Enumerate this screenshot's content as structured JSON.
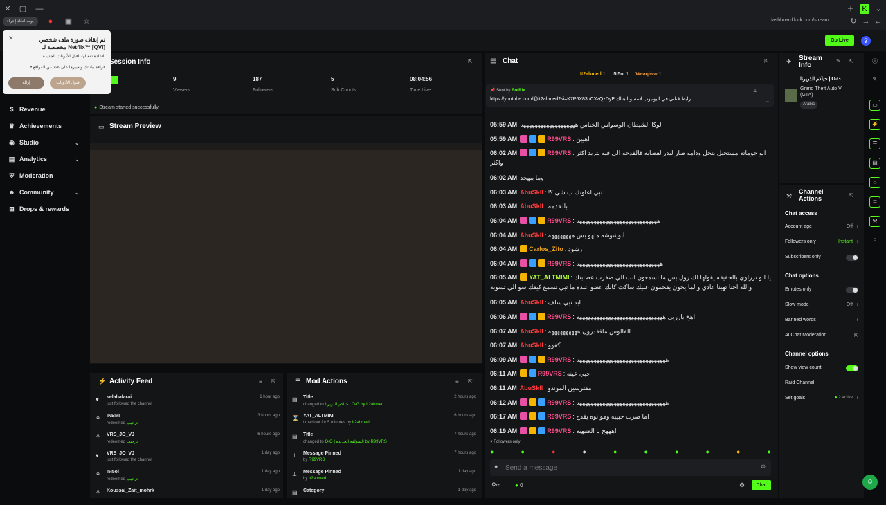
{
  "browser": {
    "url": "dashboard.kick.com/stream",
    "tab_chip": "يوب اتخاذ إجراء"
  },
  "toast": {
    "title": "تم إيقاف صورة ملف شخصي مخصصة لـ Netflix™ [QVI]",
    "line1": "لإعادة تفعيلها، اقبل الأذونات الجديدة.",
    "line2": "• قراءة بياناتك وتغييرها على عدد من المواقع",
    "accept": "قبول الأذونات",
    "remove": "إزالة"
  },
  "header": {
    "go_live": "Go Live",
    "help": "?"
  },
  "sidebar": {
    "items": [
      {
        "label": "Revenue",
        "icon": "dollar-icon"
      },
      {
        "label": "Achievements",
        "icon": "trophy-icon"
      },
      {
        "label": "Studio",
        "icon": "studio-icon"
      },
      {
        "label": "Analytics",
        "icon": "chart-icon"
      },
      {
        "label": "Moderation",
        "icon": "shield-icon"
      },
      {
        "label": "Community",
        "icon": "users-icon"
      },
      {
        "label": "Drops & rewards",
        "icon": "gift-icon"
      }
    ]
  },
  "session": {
    "title": "Session Info",
    "stats": [
      {
        "value": "9",
        "label": "Viewers"
      },
      {
        "value": "187",
        "label": "Followers"
      },
      {
        "value": "5",
        "label": "Sub Counts"
      },
      {
        "value": "08:04:56",
        "label": "Time Live"
      }
    ],
    "status": "Stream started successfully."
  },
  "preview": {
    "title": "Stream Preview"
  },
  "activity": {
    "title": "Activity Feed",
    "items": [
      {
        "name": "selahalarai",
        "sub": "just followed the channel",
        "extra": "",
        "time": "1 hour ago"
      },
      {
        "name": "INBMI",
        "sub": "redeemed",
        "extra": "ترحيب",
        "time": "3 hours ago"
      },
      {
        "name": "VRS_JO_VJ",
        "sub": "redeemed",
        "extra": "ترحيب",
        "time": "6 hours ago"
      },
      {
        "name": "VRS_JO_VJ",
        "sub": "just followed the channel",
        "extra": "",
        "time": "1 day ago"
      },
      {
        "name": "I5I5ol",
        "sub": "redeemed",
        "extra": "ترحيب",
        "time": "1 day ago"
      },
      {
        "name": "Koussai_Zait_mohrk",
        "sub": "",
        "extra": "",
        "time": "1 day ago"
      }
    ]
  },
  "mod": {
    "title": "Mod Actions",
    "items": [
      {
        "name": "Title",
        "sub": "changed to",
        "extra": "حياكم الذريرنا | O-G by It2ahmed",
        "time": "2 hours ago"
      },
      {
        "name": "YAT_ALTMIMI",
        "sub": "timed out for 5 minutes by",
        "extra": "It2ahmed",
        "time": "6 hours ago"
      },
      {
        "name": "Title",
        "sub": "changed to",
        "extra": "O-G | السولفة الجديدة by R99VRS",
        "time": "7 hours ago"
      },
      {
        "name": "Message Pinned",
        "sub": "by",
        "extra": "R99VRS",
        "time": "7 hours ago"
      },
      {
        "name": "Message Pinned",
        "sub": "by",
        "extra": "It2ahmed",
        "time": "1 day ago"
      },
      {
        "name": "Category",
        "sub": "",
        "extra": "",
        "time": "1 day ago"
      }
    ]
  },
  "chat": {
    "title": "Chat",
    "top_users": [
      {
        "name": "It2ahmed",
        "count": "1"
      },
      {
        "name": "I5I5ol",
        "count": "1"
      },
      {
        "name": "Weaqiww",
        "count": "1"
      }
    ],
    "pinned": {
      "by_label": "Sent by",
      "by_user": "BotRix",
      "text": "رابط قناتي في اليوتيوب لاتنسونا هناك https://youtube.com/@it2ahmed?si=K7P6X83nCXzQzDyP"
    },
    "messages": [
      {
        "time": "05:59 AM",
        "user": "",
        "text": "لوكا الشيطان الوسواس الخناس هههههههههههههههههههه",
        "badges": [],
        "color": "#e6e6e6"
      },
      {
        "time": "05:59 AM",
        "user": "R99VRS",
        "text": "اهيين",
        "badges": [
          "#e84fa5",
          "#3aa0ff",
          "#f5b400"
        ],
        "color": "#ff4f8b"
      },
      {
        "time": "06:02 AM",
        "user": "R99VRS",
        "text": "ابو جوماتة مستحيل يتحل ودامه صار ليدر لعصابة فالقدحه الي فيه يتزيد اكثر واكثر",
        "badges": [
          "#e84fa5",
          "#3aa0ff",
          "#f5b400"
        ],
        "color": "#ff4f8b"
      },
      {
        "time": "06:02 AM",
        "user": "",
        "text": "وما يبهجد",
        "badges": [],
        "color": "#e6e6e6"
      },
      {
        "time": "06:03 AM",
        "user": "AbuSkll",
        "text": "تبي اعاونك ب شي ؟!",
        "badges": [],
        "color": "#ff3b3b"
      },
      {
        "time": "06:03 AM",
        "user": "AbuSkll",
        "text": "بالخدمه",
        "badges": [],
        "color": "#ff3b3b"
      },
      {
        "time": "06:04 AM",
        "user": "R99VRS",
        "text": "ههههههههههههههههههههههههههههه",
        "badges": [
          "#e84fa5",
          "#3aa0ff",
          "#f5b400"
        ],
        "color": "#ff4f8b"
      },
      {
        "time": "06:04 AM",
        "user": "AbuSkll",
        "text": "ابوشوشه متهو بس ههههههههه",
        "badges": [],
        "color": "#ff3b3b"
      },
      {
        "time": "06:04 AM",
        "user": "Carlos_Zito",
        "text": "رشود",
        "badges": [
          "#f5b400"
        ],
        "color": "#e8a020"
      },
      {
        "time": "06:04 AM",
        "user": "R99VRS",
        "text": "هههههههههههههههههههههههههههههه",
        "badges": [
          "#e84fa5",
          "#3aa0ff",
          "#f5b400"
        ],
        "color": "#ff4f8b"
      },
      {
        "time": "06:05 AM",
        "user": "YAT_ALTMIMI",
        "text": "يا ابو نزراوي بالحقيقه يقولها لك رول بس ما تسمعون انت الي صفرت عصابتك والله احنا تهينا عادي و لما يجون يقحمون عليك ساكت كانك عضو عنده ما تبي تسمع كيفك سو الي تسويه",
        "badges": [
          "#f5b400"
        ],
        "color": "#b4ff39"
      },
      {
        "time": "06:05 AM",
        "user": "AbuSkll",
        "text": "ابد تبي سلف",
        "badges": [],
        "color": "#ff3b3b"
      },
      {
        "time": "06:06 AM",
        "user": "R99VRS",
        "text": "اهخ يارربي ههههههههههههههههههههههههههههههه",
        "badges": [
          "#e84fa5",
          "#3aa0ff",
          "#f5b400"
        ],
        "color": "#ff4f8b"
      },
      {
        "time": "06:07 AM",
        "user": "AbuSkll",
        "text": "الفالوس مافقدرون ههههههههههه",
        "badges": [],
        "color": "#ff3b3b"
      },
      {
        "time": "06:07 AM",
        "user": "AbuSkll",
        "text": "كفوو",
        "badges": [],
        "color": "#ff3b3b"
      },
      {
        "time": "06:09 AM",
        "user": "R99VRS",
        "text": "هههههههههههههههههههههههههههههههه",
        "badges": [
          "#e84fa5",
          "#3aa0ff",
          "#f5b400"
        ],
        "color": "#ff4f8b"
      },
      {
        "time": "06:11 AM",
        "user": "R99VRS",
        "text": "حبي عينه",
        "badges": [
          "#f5b400",
          "#3aa0ff"
        ],
        "color": "#ff4f8b"
      },
      {
        "time": "06:11 AM",
        "user": "AbuSkll",
        "text": "مفترسين الموندو",
        "badges": [],
        "color": "#ff3b3b"
      },
      {
        "time": "06:12 AM",
        "user": "R99VRS",
        "text": "هههههههههههههههههههههههههههههههه",
        "badges": [
          "#e84fa5",
          "#f5b400",
          "#3aa0ff"
        ],
        "color": "#ff4f8b"
      },
      {
        "time": "06:17 AM",
        "user": "R99VRS",
        "text": "اما صرت حبيبه وهو توه يقدح",
        "badges": [
          "#e84fa5",
          "#f5b400",
          "#3aa0ff"
        ],
        "color": "#ff4f8b"
      },
      {
        "time": "06:19 AM",
        "user": "R99VRS",
        "text": "اهههخ يا الغنيهيه",
        "badges": [
          "#e84fa5",
          "#f5b400",
          "#3aa0ff"
        ],
        "color": "#ff4f8b"
      }
    ],
    "followers_only": "Followers only",
    "input_placeholder": "Send a message",
    "viewer_count": "0",
    "send_label": "Chat"
  },
  "stream_info": {
    "title": "Stream Info",
    "stream_title": "حياكم الذريرنا | O-G",
    "category": "Grand Theft Auto V (GTA)",
    "language": "Arabic"
  },
  "channel_actions": {
    "title": "Channel Actions",
    "chat_access": "Chat access",
    "account_age": {
      "label": "Account age",
      "value": "Off"
    },
    "followers_only": {
      "label": "Followers only",
      "value": "Instant"
    },
    "subscribers_only": {
      "label": "Subscribers only"
    },
    "chat_options": "Chat options",
    "emotes_only": {
      "label": "Emotes only"
    },
    "slow_mode": {
      "label": "Slow mode",
      "value": "Off"
    },
    "banned_words": {
      "label": "Banned words"
    },
    "ai_mod": {
      "label": "AI Chat Moderation"
    },
    "channel_options": "Channel options",
    "show_view_count": {
      "label": "Show view count"
    },
    "raid_channel": {
      "label": "Raid Channel"
    },
    "set_goals": {
      "label": "Set goals",
      "value": "2 active"
    }
  },
  "colors": {
    "accent": "#53fc18",
    "bg": "#0b0c0e",
    "panel": "#141517"
  }
}
